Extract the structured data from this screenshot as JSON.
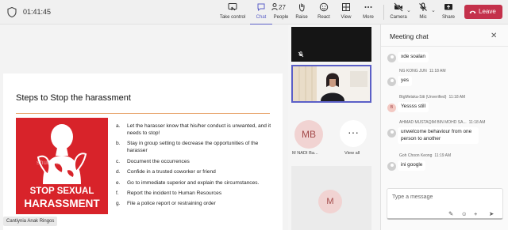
{
  "meeting": {
    "timer": "01:41:45"
  },
  "toolbar": {
    "take_control": "Take control",
    "chat": "Chat",
    "people": "People",
    "people_count": "27",
    "raise": "Raise",
    "react": "React",
    "view": "View",
    "more": "More",
    "camera": "Camera",
    "mic": "Mic",
    "share": "Share",
    "leave": "Leave"
  },
  "slide": {
    "title": "Steps to Stop the harassment",
    "poster_line1": "STOP SEXUAL",
    "poster_line2": "HARASSMENT",
    "watermark": "shutterstock",
    "steps": [
      {
        "letter": "a.",
        "text": "Let the harasser know that his/her conduct is unwanted, and it needs to stop!"
      },
      {
        "letter": "b.",
        "text": "Stay in group setting to decrease the opportunities of the harasser"
      },
      {
        "letter": "c.",
        "text": "Document the occurrences"
      },
      {
        "letter": "d.",
        "text": "Confide in a trusted coworker or friend"
      },
      {
        "letter": "e.",
        "text": "Go to immediate superior and explain the circumstances."
      },
      {
        "letter": "f.",
        "text": "Report the incident to Human Resources"
      },
      {
        "letter": "g.",
        "text": "File a police report or restraining order"
      }
    ]
  },
  "presenter": "Cantiynia Anak Ringos",
  "participants": {
    "mb_initials": "MB",
    "mb_name": "M NADI Ba...",
    "view_all_label": "View all",
    "m_initial": "M"
  },
  "chat": {
    "title": "Meeting chat",
    "messages": [
      {
        "sender": "",
        "time": "",
        "text": "xde soalan"
      },
      {
        "sender": "NG KONG JUN",
        "time": "11:18 AM",
        "text": "yes"
      },
      {
        "sender": "BtgMelaka-Siti (Unverified)",
        "time": "11:18 AM",
        "text": "Yessss still",
        "initial": "B"
      },
      {
        "sender": "AHMAD MUSTAQIM BIN MOHD SA...",
        "time": "11:18 AM",
        "text": "unwelcome behaviour from one person to another"
      },
      {
        "sender": "Goh Choon Keong",
        "time": "11:19 AM",
        "text": "ini google"
      }
    ],
    "placeholder": "Type a message"
  },
  "colors": {
    "accent": "#5b5fc7",
    "leave": "#c4314b",
    "poster": "#d8232a",
    "rule": "#e8a46b"
  }
}
